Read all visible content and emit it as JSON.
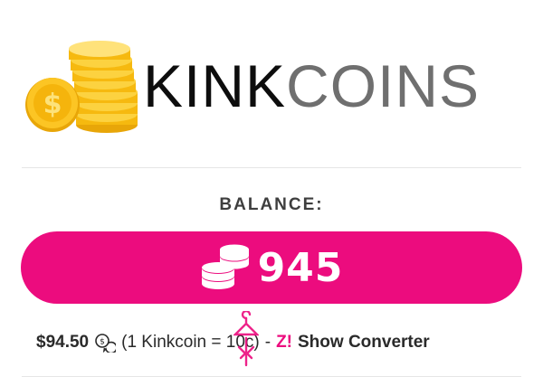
{
  "logo": {
    "brand_part1": "KINK",
    "brand_part2": "COINS",
    "icon": "gold-coin-stack-icon"
  },
  "balance": {
    "label": "BALANCE:",
    "amount": "945",
    "icon": "coin-stack-icon"
  },
  "info": {
    "usd_value": "$94.50",
    "rate_text": "(1 Kinkcoin = 10c)",
    "separator": "-",
    "converter_icon": "Z!",
    "converter_label": "Show Converter"
  },
  "colors": {
    "accent": "#ec0c7e",
    "coin_gold": "#f9c11a",
    "text_dark": "#2a2a2a",
    "label_gray": "#3e3e3e"
  }
}
